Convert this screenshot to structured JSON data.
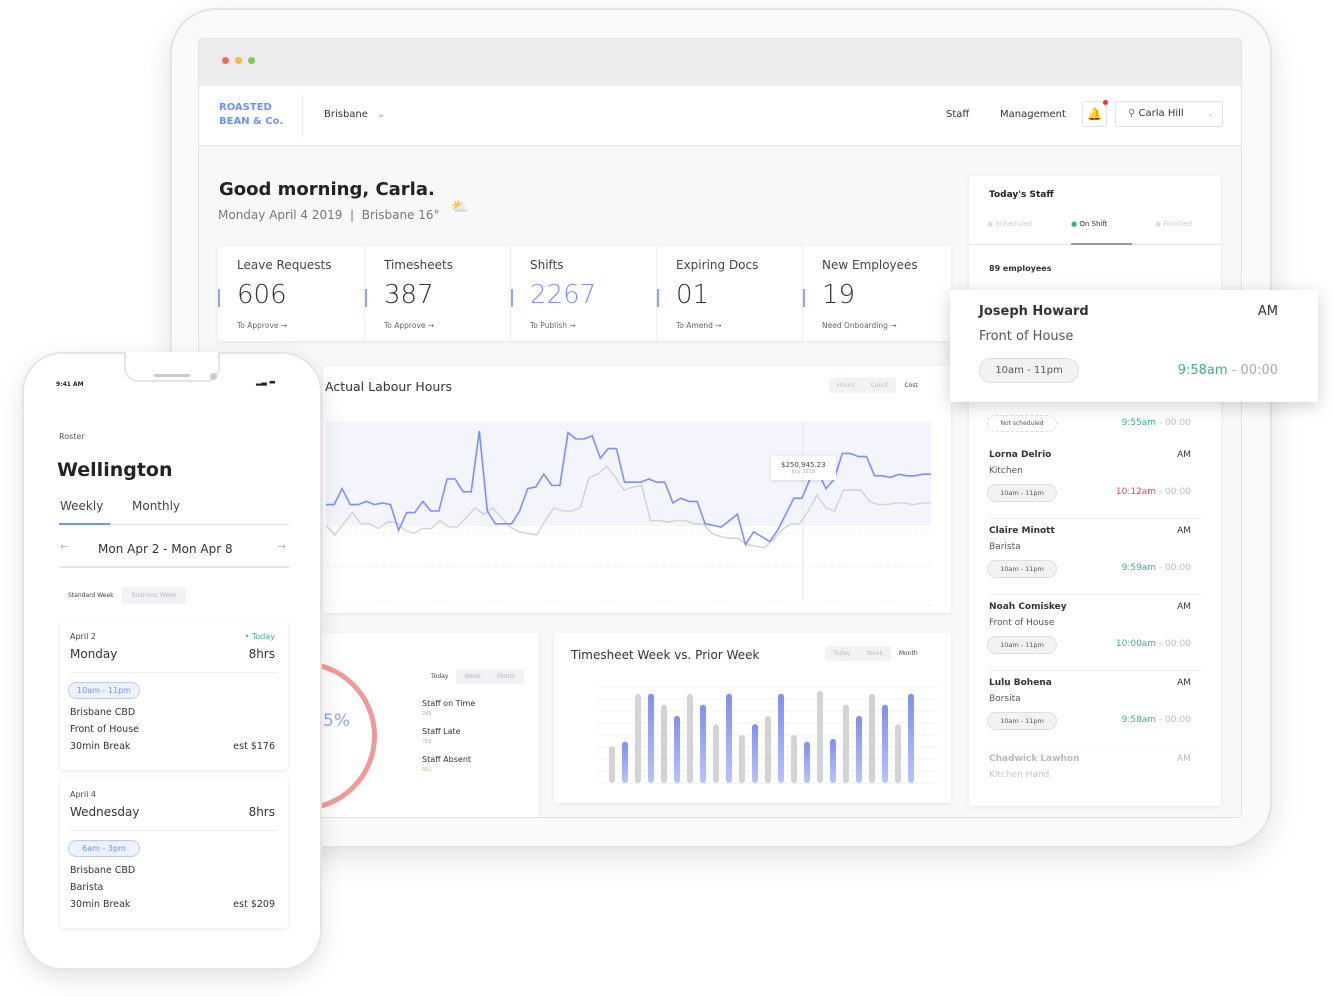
{
  "header": {
    "logo_line1": "ROASTED",
    "logo_line2": "BEAN & Co.",
    "location": "Brisbane",
    "nav": [
      "Staff",
      "Management"
    ],
    "user": "Carla Hill"
  },
  "greeting": {
    "title": "Good morning, Carla.",
    "subtitle": "Monday April 4 2019  |  Brisbane 16°"
  },
  "stats": [
    {
      "label": "Leave Requests",
      "value": "606",
      "sub": "To Approve →"
    },
    {
      "label": "Timesheets",
      "value": "387",
      "sub": "To Approve →"
    },
    {
      "label": "Shifts",
      "value": "2267",
      "sub": "To Publish →"
    },
    {
      "label": "Expiring Docs",
      "value": "01",
      "sub": "To Amend →"
    },
    {
      "label": "New Employees",
      "value": "19",
      "sub": "Need Onboarding →"
    }
  ],
  "colors": {
    "accent": "#7f8ff0",
    "green": "#3fae8a",
    "red": "#e0456a",
    "gray_series": "#d4d4d4",
    "donut": "#ee9a9a"
  },
  "today_staff": {
    "title": "Today's Staff",
    "tabs": [
      "Scheduled",
      "On Shift",
      "Finished"
    ],
    "active_tab": 1,
    "count": "89 employees",
    "featured": {
      "name": "Joseph Howard",
      "role": "Front of House",
      "period": "AM",
      "shift": "10am - 11pm",
      "clock_in": "9:58am",
      "clock_out": "- 00:00"
    },
    "not_scheduled": {
      "pill": "Not scheduled",
      "clock_in": "9:55am",
      "clock_out": "- 00:00"
    },
    "items": [
      {
        "name": "Lorna Delrio",
        "role": "Kitchen",
        "period": "AM",
        "shift": "10am - 11pm",
        "clock_in": "10:12am",
        "clock_out": "- 00:00",
        "late": true
      },
      {
        "name": "Claire Minott",
        "role": "Barista",
        "period": "AM",
        "shift": "10am - 11pm",
        "clock_in": "9:59am",
        "clock_out": "- 00:00"
      },
      {
        "name": "Noah Comiskey",
        "role": "Front of House",
        "period": "AM",
        "shift": "10am - 11pm",
        "clock_in": "10:00am",
        "clock_out": "- 00:00"
      },
      {
        "name": "Lulu Bohena",
        "role": "Borsita",
        "period": "AM",
        "shift": "10am - 11pm",
        "clock_in": "9:58am",
        "clock_out": "- 00:00"
      },
      {
        "name": "Chadwick Lawhon",
        "role": "Kitchen Hand",
        "period": "AM"
      }
    ]
  },
  "labour": {
    "title": "Actual Labour Hours",
    "toggle": [
      "Hours",
      "Count",
      "Cost"
    ],
    "active": 2,
    "tooltip_value": "$250,945.23",
    "tooltip_date": "July 2019"
  },
  "attendance": {
    "percent_text": "5%",
    "toggle": [
      "Today",
      "Week",
      "Month"
    ],
    "active": 0,
    "rows": [
      {
        "label": "Staff on Time",
        "value": "245"
      },
      {
        "label": "Staff Late",
        "value": "756"
      },
      {
        "label": "Staff Absent",
        "value": "401"
      }
    ]
  },
  "timesheet": {
    "title": "Timesheet Week vs. Prior Week",
    "toggle": [
      "Today",
      "Week",
      "Month"
    ],
    "active": 2
  },
  "chart_data": [
    {
      "type": "line",
      "title": "Actual Labour Hours",
      "grid": true,
      "series": [
        {
          "color": "#7f8ff0",
          "values": [
            54,
            54,
            64,
            54,
            54,
            56,
            54,
            55,
            54,
            38,
            49,
            49,
            56,
            50,
            50,
            70,
            70,
            62,
            62,
            100,
            50,
            42,
            42,
            42,
            50,
            64,
            65,
            73,
            66,
            66,
            99,
            95,
            95,
            97,
            83,
            89,
            89,
            68,
            68,
            68,
            70,
            68,
            68,
            55,
            58,
            56,
            56,
            42,
            41,
            40,
            44,
            48,
            29,
            37,
            34,
            31,
            38,
            48,
            58,
            58,
            70,
            74,
            64,
            70,
            86,
            86,
            84,
            84,
            72,
            72,
            71,
            73,
            72,
            72,
            73,
            73
          ]
        },
        {
          "color": "#d4d4d4",
          "values": [
            41,
            35,
            42,
            49,
            42,
            42,
            39,
            43,
            43,
            38,
            36,
            39,
            39,
            44,
            40,
            40,
            46,
            52,
            48,
            52,
            46,
            40,
            37,
            36,
            35,
            44,
            52,
            50,
            50,
            52,
            71,
            73,
            78,
            71,
            63,
            65,
            66,
            44,
            44,
            43,
            44,
            44,
            42,
            42,
            36,
            34,
            33,
            33,
            29,
            28,
            27,
            32,
            38,
            42,
            42,
            50,
            60,
            52,
            50,
            63,
            63,
            63,
            56,
            54,
            54,
            55,
            55,
            54,
            55,
            55
          ]
        }
      ]
    },
    {
      "type": "bar",
      "title": "Timesheet Week vs. Prior Week",
      "series": [
        {
          "color": "#d4d4d4",
          "values": [
            40,
            97,
            85,
            97,
            64,
            52,
            73,
            52,
            100,
            85,
            97,
            64
          ]
        },
        {
          "color": "#7f8ff0",
          "values": [
            45,
            97,
            73,
            85,
            97,
            64,
            97,
            45,
            48,
            73,
            85,
            97
          ]
        }
      ]
    }
  ],
  "phone": {
    "time": "9:41 AM",
    "section": "Roster",
    "title": "Wellington",
    "tabs": [
      "Weekly",
      "Monthly"
    ],
    "range": "Mon Apr 2 - Mon Apr 8",
    "week_toggle": [
      "Standard Week",
      "Business Week"
    ],
    "days": [
      {
        "date": "April 2",
        "day": "Monday",
        "today": "• Today",
        "hours": "8hrs",
        "shift": "10am - 11pm",
        "location": "Brisbane CBD",
        "role": "Front of House",
        "break": "30min Break",
        "est": "est $176"
      },
      {
        "date": "April 4",
        "day": "Wednesday",
        "hours": "8hrs",
        "shift": "6am - 3pm",
        "location": "Brisbane CBD",
        "role": "Barista",
        "break": "30min Break",
        "est": "est $209"
      }
    ]
  }
}
